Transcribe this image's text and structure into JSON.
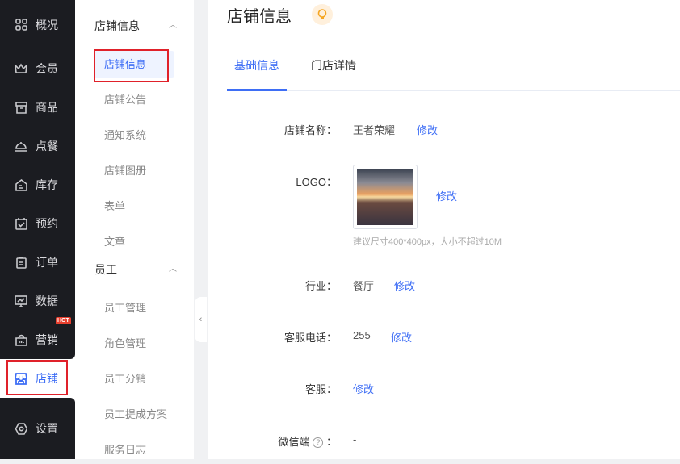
{
  "sidebar": {
    "items": [
      {
        "label": "概况",
        "icon": "grid-icon"
      },
      {
        "label": "会员",
        "icon": "crown-icon"
      },
      {
        "label": "商品",
        "icon": "box-icon"
      },
      {
        "label": "点餐",
        "icon": "cloche-icon"
      },
      {
        "label": "库存",
        "icon": "warehouse-icon"
      },
      {
        "label": "预约",
        "icon": "calendar-check-icon"
      },
      {
        "label": "订单",
        "icon": "clipboard-icon"
      },
      {
        "label": "数据",
        "icon": "chart-monitor-icon"
      },
      {
        "label": "营销",
        "icon": "shop-bag-icon",
        "badge": "HOT"
      },
      {
        "label": "店铺",
        "icon": "store-icon",
        "active": true
      },
      {
        "label": "设置",
        "icon": "settings-icon"
      }
    ]
  },
  "submenu": {
    "groups": [
      {
        "title": "店铺信息",
        "items": [
          "店铺信息",
          "店铺公告",
          "通知系统",
          "店铺图册",
          "表单",
          "文章"
        ]
      },
      {
        "title": "员工",
        "items": [
          "员工管理",
          "角色管理",
          "员工分销",
          "员工提成方案",
          "服务日志"
        ]
      }
    ]
  },
  "main": {
    "title": "店铺信息",
    "tabs": [
      "基础信息",
      "门店详情"
    ],
    "fields": {
      "name_label": "店铺名称：",
      "name_value": "王者荣耀",
      "logo_label": "LOGO：",
      "logo_hint": "建议尺寸400*400px，大小不超过10M",
      "industry_label": "行业：",
      "industry_value": "餐厅",
      "phone_label": "客服电话：",
      "phone_value": "255",
      "service_label": "客服：",
      "wechat_label": "微信端",
      "wechat_colon": "：",
      "wechat_value": "-"
    },
    "edit_label": "修改"
  },
  "colors": {
    "accent": "#3e6ef5",
    "sidebar_bg": "#1b1c21",
    "highlight": "#e0212a"
  }
}
